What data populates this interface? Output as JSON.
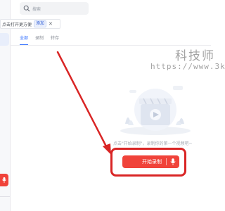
{
  "search": {
    "placeholder": "搜索",
    "icon": "search-icon"
  },
  "tip_bar": {
    "text": "点击打开更方便",
    "add_label": "添加",
    "close_label": "✕"
  },
  "tabs": [
    {
      "label": "全部",
      "active": true
    },
    {
      "label": "录制",
      "active": false
    },
    {
      "label": "转存",
      "active": false
    }
  ],
  "watermark": {
    "title": "科技师",
    "url": "https://www.3k"
  },
  "empty_state": {
    "hint_prefix": "点击",
    "hint_link": "\"开始录制\"",
    "hint_suffix": "，录制你的第一个视频吧~",
    "illustration_icon": "video-play-illustration"
  },
  "record_button": {
    "label": "开始录制",
    "icon": "mic-icon"
  },
  "colors": {
    "accent_blue": "#3370ff",
    "record_red": "#f0433a",
    "annotation_red": "#d92525"
  },
  "sidebar": {
    "record_icon": "mic-icon"
  }
}
